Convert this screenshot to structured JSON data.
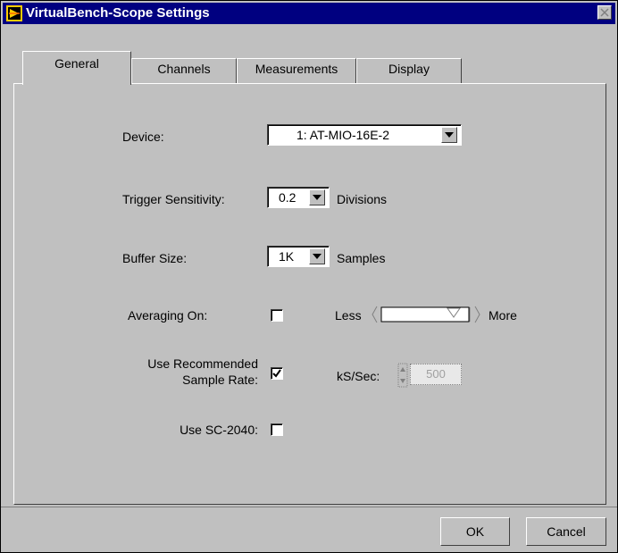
{
  "window": {
    "title": "VirtualBench-Scope Settings"
  },
  "tabs": [
    {
      "label": "General",
      "active": true
    },
    {
      "label": "Channels",
      "active": false
    },
    {
      "label": "Measurements",
      "active": false
    },
    {
      "label": "Display",
      "active": false
    }
  ],
  "general": {
    "device": {
      "label": "Device:",
      "value": "1: AT-MIO-16E-2"
    },
    "trigger_sensitivity": {
      "label": "Trigger Sensitivity:",
      "value": "0.2",
      "unit": "Divisions"
    },
    "buffer_size": {
      "label": "Buffer Size:",
      "value": "1K",
      "unit": "Samples"
    },
    "averaging": {
      "label": "Averaging On:",
      "checked": false,
      "less_label": "Less",
      "more_label": "More"
    },
    "recommended_rate": {
      "label_line1": "Use Recommended",
      "label_line2": "Sample Rate:",
      "checked": true
    },
    "sample_rate": {
      "label": "kS/Sec:",
      "value": "500"
    },
    "sc2040": {
      "label": "Use SC-2040:",
      "checked": false
    }
  },
  "buttons": {
    "ok_label": "OK",
    "cancel_label": "Cancel"
  },
  "colors": {
    "titlebar": "#000080",
    "face": "#c0c0c0"
  }
}
